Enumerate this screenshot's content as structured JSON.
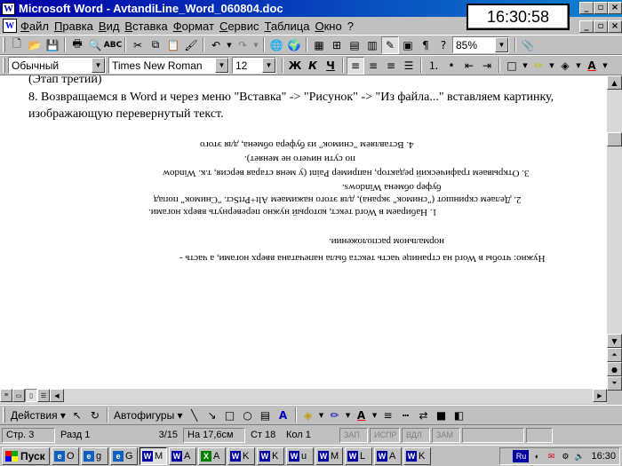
{
  "window": {
    "app_title": "Microsoft Word - AvtandiLine_Word_060804.doc",
    "clock_overlay": "16:30:58"
  },
  "menu": [
    "Файл",
    "Правка",
    "Вид",
    "Вставка",
    "Формат",
    "Сервис",
    "Таблица",
    "Окно",
    "?"
  ],
  "standard_toolbar": {
    "zoom": "85%"
  },
  "format_toolbar": {
    "style": "Обычный",
    "font": "Times New Roman",
    "size": "12",
    "bold": "Ж",
    "italic": "К",
    "underline": "Ч"
  },
  "document": {
    "cut_line": "(Этап третий)",
    "para_line1": "8. Возвращаемся в Word и через меню \"Вставка\" -> \"Рисунок\" -> \"Из файла...\" вставляем картинку,",
    "para_line2": "изображающую перевернутый текст.",
    "flipped": [
      "4. Вставляем \"снимок\" из буфера обмена, для этого",
      "по сути ничего не меняет).",
      "3. Открываем графический редактор, например Paint (у меня старая версия, т.к. Window",
      "буфер обмена Windows.",
      "2. Делаем скриншот (\"снимок\" экрана), для этого нажимаем Alt+PrtScr. \"Снимок\" попад",
      "1. Набираем в Word текст, который нужно перевернуть вверх ногами.",
      "нормальном расположении.",
      "Нужно: чтобы в Word на странице часть текста была напечатана вверх ногами, а часть -"
    ]
  },
  "drawing_toolbar": {
    "actions": "Действия",
    "autoshapes": "Автофигуры"
  },
  "status": {
    "page": "Стр. 3",
    "section": "Разд 1",
    "pages": "3/15",
    "at": "На 17,6см",
    "line": "Ст 18",
    "col": "Кол 1",
    "rec": "ЗАП",
    "trk": "ИСПР",
    "ext": "ВДЛ",
    "ovr": "ЗАМ"
  },
  "taskbar": {
    "start": "Пуск",
    "tasks": [
      {
        "icon": "e-icon",
        "glyph": "e",
        "label": "O",
        "color": "#1060c0"
      },
      {
        "icon": "e-icon",
        "glyph": "e",
        "label": "g",
        "color": "#1060c0"
      },
      {
        "icon": "e-icon",
        "glyph": "e",
        "label": "G",
        "color": "#1060c0"
      },
      {
        "icon": "word-icon",
        "glyph": "W",
        "label": "M",
        "color": "#0000a0",
        "active": true
      },
      {
        "icon": "word-icon",
        "glyph": "W",
        "label": "A",
        "color": "#0000a0"
      },
      {
        "icon": "excel-icon",
        "glyph": "X",
        "label": "A",
        "color": "#008000"
      },
      {
        "icon": "word-icon",
        "glyph": "W",
        "label": "K",
        "color": "#0000a0"
      },
      {
        "icon": "word-icon",
        "glyph": "W",
        "label": "K",
        "color": "#0000a0"
      },
      {
        "icon": "word-icon",
        "glyph": "W",
        "label": "u",
        "color": "#0000a0"
      },
      {
        "icon": "word-icon",
        "glyph": "W",
        "label": "M",
        "color": "#0000a0"
      },
      {
        "icon": "word-icon",
        "glyph": "W",
        "label": "L",
        "color": "#0000a0"
      },
      {
        "icon": "word-icon",
        "glyph": "W",
        "label": "A",
        "color": "#0000a0"
      },
      {
        "icon": "word-icon",
        "glyph": "W",
        "label": "K",
        "color": "#0000a0"
      }
    ],
    "lang": "Ru",
    "time": "16:30"
  }
}
